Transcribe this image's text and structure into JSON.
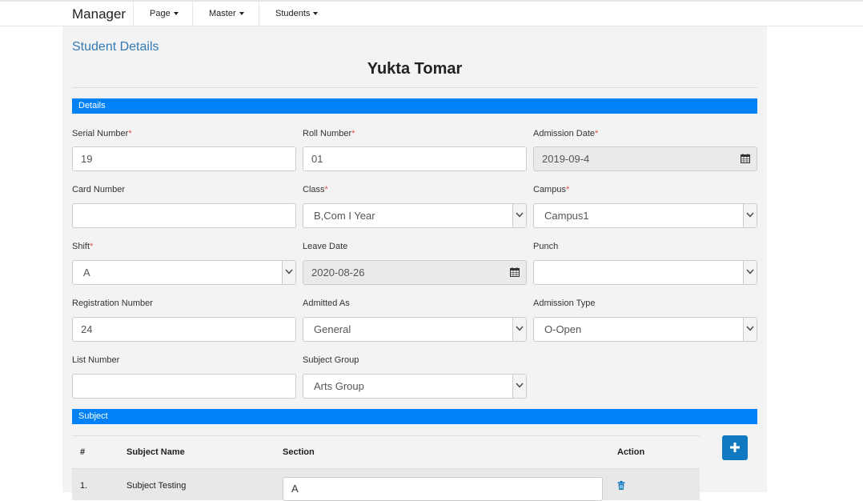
{
  "nav": {
    "brand": "Manager",
    "menus": [
      "Page",
      "Master",
      "Students"
    ]
  },
  "header": {
    "title": "Student Details",
    "student_name": "Yukta Tomar"
  },
  "sections": {
    "details": "Details",
    "subject": "Subject"
  },
  "fields": {
    "serial_number": {
      "label": "Serial Number",
      "value": "19"
    },
    "roll_number": {
      "label": "Roll Number",
      "value": "01"
    },
    "admission_date": {
      "label": "Admission Date",
      "value": "2019-09-4"
    },
    "card_number": {
      "label": "Card Number",
      "value": ""
    },
    "class": {
      "label": "Class",
      "value": "B,Com I Year"
    },
    "campus": {
      "label": "Campus",
      "value": "Campus1"
    },
    "shift": {
      "label": "Shift",
      "value": "A"
    },
    "leave_date": {
      "label": "Leave Date",
      "value": "2020-08-26"
    },
    "punch": {
      "label": "Punch",
      "value": ""
    },
    "registration_number": {
      "label": "Registration Number",
      "value": "24"
    },
    "admitted_as": {
      "label": "Admitted As",
      "value": "General"
    },
    "admission_type": {
      "label": "Admission Type",
      "value": "O-Open"
    },
    "list_number": {
      "label": "List Number",
      "value": ""
    },
    "subject_group": {
      "label": "Subject Group",
      "value": "Arts Group"
    }
  },
  "required_mark": "*",
  "subject_table": {
    "columns": [
      "#",
      "Subject Name",
      "Section",
      "Action"
    ],
    "rows": [
      {
        "index": "1.",
        "subject": "Subject Testing",
        "section": "A"
      }
    ]
  },
  "icons": {
    "calendar": "calendar-icon",
    "trash": "trash-icon",
    "add": "plus-icon",
    "dropdown": "chevron-down-icon"
  },
  "colors": {
    "section_bar": "#0081f8",
    "add_button": "#1179bf",
    "title_link": "#337ab7",
    "required": "#d9534f"
  }
}
